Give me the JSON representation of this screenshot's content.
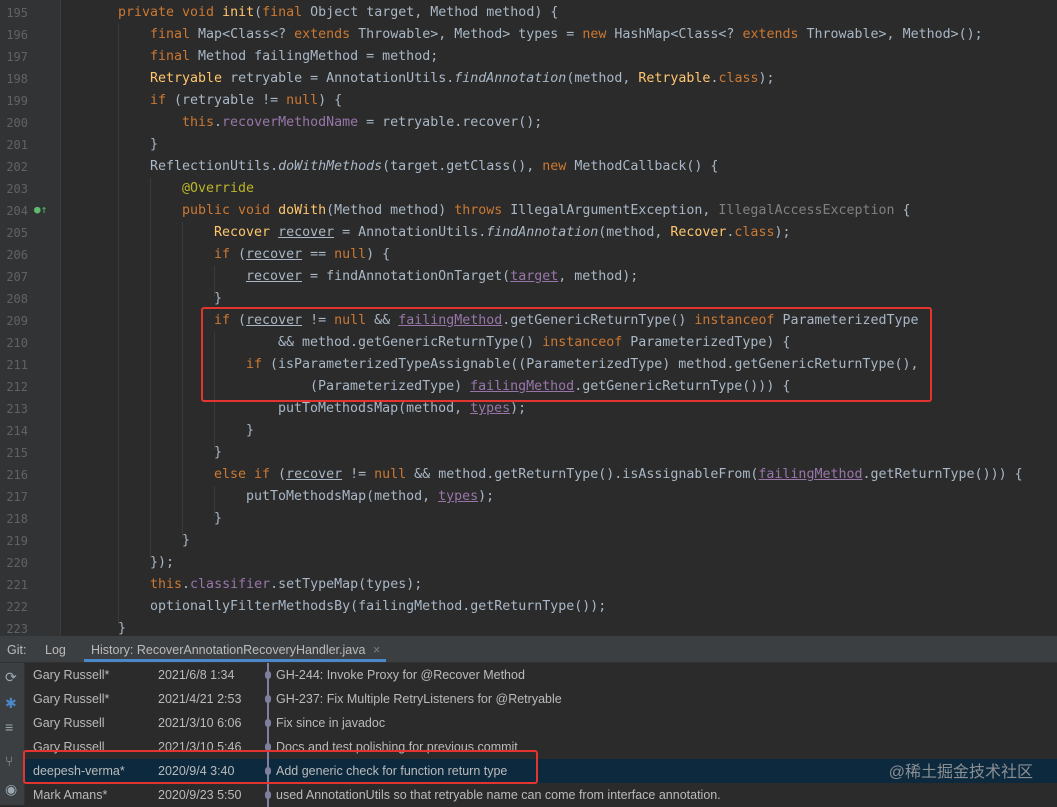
{
  "editor": {
    "line_numbers": [
      "195",
      "196",
      "197",
      "198",
      "199",
      "200",
      "201",
      "202",
      "203",
      "204",
      "205",
      "206",
      "207",
      "208",
      "209",
      "210",
      "211",
      "212",
      "213",
      "214",
      "215",
      "216",
      "217",
      "218",
      "219",
      "220",
      "221",
      "222",
      "223"
    ]
  },
  "panel": {
    "tab_git": "Git:",
    "tab_log": "Log",
    "tab_history": "History: RecoverAnnotationRecoveryHandler.java",
    "tab_close": "×",
    "commits": [
      {
        "author": "Gary Russell*",
        "date": "2021/6/8 1:34",
        "message": "GH-244: Invoke Proxy for @Recover Method"
      },
      {
        "author": "Gary Russell*",
        "date": "2021/4/21 2:53",
        "message": "GH-237: Fix Multiple RetryListeners for @Retryable"
      },
      {
        "author": "Gary Russell",
        "date": "2021/3/10 6:06",
        "message": "Fix since in javadoc"
      },
      {
        "author": "Gary Russell",
        "date": "2021/3/10 5:46",
        "message": "Docs and test polishing for previous commit"
      },
      {
        "author": "deepesh-verma*",
        "date": "2020/9/4 3:40",
        "message": "Add generic check for function return type"
      },
      {
        "author": "Mark Amans*",
        "date": "2020/9/23 5:50",
        "message": "used AnnotationUtils so that retryable name can come from interface annotation."
      }
    ],
    "watermark": "@稀土掘金技术社区"
  },
  "colors": {
    "highlight_border": "#e3342f",
    "selected_row": "#0d293e",
    "keyword": "#cc7832"
  }
}
